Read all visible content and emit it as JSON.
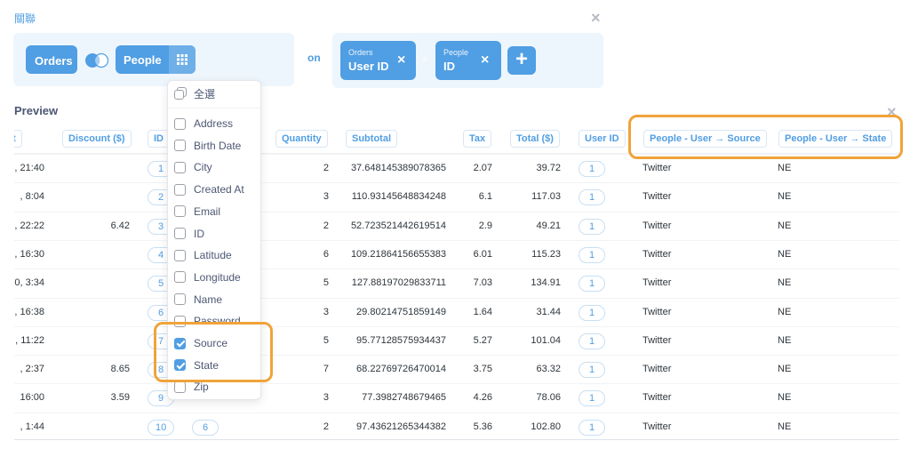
{
  "dialog": {
    "title": "關聯"
  },
  "join": {
    "left_table": "Orders",
    "right_table": "People",
    "on_label": "on",
    "left_field": {
      "table": "Orders",
      "field": "User ID"
    },
    "operator": "=",
    "right_field": {
      "table": "People",
      "field": "ID"
    },
    "add_label": "+"
  },
  "preview": {
    "title": "Preview",
    "headers": {
      "created_at": "At",
      "discount": "Discount ($)",
      "id": "ID",
      "quantity": "Quantity",
      "subtotal": "Subtotal",
      "tax": "Tax",
      "total": "Total ($)",
      "user_id": "User ID",
      "source": "People - User → Source",
      "state": "People - User → State"
    },
    "rows": [
      {
        "created_at": ", 21:40",
        "discount": "",
        "id": "1",
        "product_id": "",
        "quantity": "2",
        "subtotal": "37.648145389078365",
        "tax": "2.07",
        "total": "39.72",
        "user_id": "1",
        "source": "Twitter",
        "state": "NE"
      },
      {
        "created_at": ", 8:04",
        "discount": "",
        "id": "2",
        "product_id": "",
        "quantity": "3",
        "subtotal": "110.93145648834248",
        "tax": "6.1",
        "total": "117.03",
        "user_id": "1",
        "source": "Twitter",
        "state": "NE"
      },
      {
        "created_at": ", 22:22",
        "discount": "6.42",
        "id": "3",
        "product_id": "",
        "quantity": "2",
        "subtotal": "52.723521442619514",
        "tax": "2.9",
        "total": "49.21",
        "user_id": "1",
        "source": "Twitter",
        "state": "NE"
      },
      {
        "created_at": ", 16:30",
        "discount": "",
        "id": "4",
        "product_id": "",
        "quantity": "6",
        "subtotal": "109.21864156655383",
        "tax": "6.01",
        "total": "115.23",
        "user_id": "1",
        "source": "Twitter",
        "state": "NE"
      },
      {
        "created_at": "0, 3:34",
        "discount": "",
        "id": "5",
        "product_id": "",
        "quantity": "5",
        "subtotal": "127.88197029833711",
        "tax": "7.03",
        "total": "134.91",
        "user_id": "1",
        "source": "Twitter",
        "state": "NE"
      },
      {
        "created_at": ", 16:38",
        "discount": "",
        "id": "6",
        "product_id": "",
        "quantity": "3",
        "subtotal": "29.80214751859149",
        "tax": "1.64",
        "total": "31.44",
        "user_id": "1",
        "source": "Twitter",
        "state": "NE"
      },
      {
        "created_at": ", 11:22",
        "discount": "",
        "id": "7",
        "product_id": "",
        "quantity": "5",
        "subtotal": "95.77128575934437",
        "tax": "5.27",
        "total": "101.04",
        "user_id": "1",
        "source": "Twitter",
        "state": "NE"
      },
      {
        "created_at": ", 2:37",
        "discount": "8.65",
        "id": "8",
        "product_id": "",
        "quantity": "7",
        "subtotal": "68.22769726470014",
        "tax": "3.75",
        "total": "63.32",
        "user_id": "1",
        "source": "Twitter",
        "state": "NE"
      },
      {
        "created_at": "16:00",
        "discount": "3.59",
        "id": "9",
        "product_id": "",
        "quantity": "3",
        "subtotal": "77.3982748679465",
        "tax": "4.26",
        "total": "78.06",
        "user_id": "1",
        "source": "Twitter",
        "state": "NE"
      },
      {
        "created_at": ", 1:44",
        "discount": "",
        "id": "10",
        "product_id": "6",
        "quantity": "2",
        "subtotal": "97.43621265344382",
        "tax": "5.36",
        "total": "102.80",
        "user_id": "1",
        "source": "Twitter",
        "state": "NE"
      }
    ]
  },
  "column_picker": {
    "select_all": "全選",
    "options": [
      {
        "label": "Address",
        "checked": false
      },
      {
        "label": "Birth Date",
        "checked": false
      },
      {
        "label": "City",
        "checked": false
      },
      {
        "label": "Created At",
        "checked": false
      },
      {
        "label": "Email",
        "checked": false
      },
      {
        "label": "ID",
        "checked": false
      },
      {
        "label": "Latitude",
        "checked": false
      },
      {
        "label": "Longitude",
        "checked": false
      },
      {
        "label": "Name",
        "checked": false
      },
      {
        "label": "Password",
        "checked": false
      },
      {
        "label": "Source",
        "checked": true
      },
      {
        "label": "State",
        "checked": true
      },
      {
        "label": "Zip",
        "checked": false
      }
    ]
  },
  "colors": {
    "brand": "#509ee3",
    "highlight": "#f0a33a"
  }
}
